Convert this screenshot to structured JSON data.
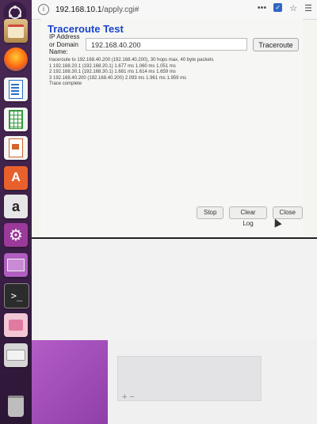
{
  "browser": {
    "url_host": "192.168.10.1",
    "url_path": "/apply.cgi#",
    "menu_icon": "hamburger-icon"
  },
  "dialog": {
    "title": "Traceroute Test",
    "label_lines": [
      "IP Address",
      "or Domain",
      "Name:"
    ],
    "ip_value": "192.168.40.200",
    "traceroute_button": "Traceroute",
    "log": [
      "traceroute to 192.168.40.200 (192.168.40.200), 30 hops max, 40 byte packets",
      "1 192.168.20.1 (192.168.20.1) 1.677 ms 1.060 ms 1.051 ms",
      "2 192.168.30.1 (192.168.30.1) 1.681 ms 1.614 ms 1.659 ms",
      "3 192.168.40.200 (192.168.40.200) 2.093 ms 1.961 ms 1.959 ms",
      "Trace complete"
    ],
    "stop_button": "Stop",
    "clear_log_button": "Clear Log",
    "close_button": "Close"
  },
  "bottom_panel": {
    "add_remove": "+ −"
  },
  "launcher": {
    "items": [
      {
        "icon": "ubuntu-logo-icon",
        "color": "#e95420"
      },
      {
        "icon": "files-icon",
        "color": "#c9a56a"
      },
      {
        "icon": "firefox-icon",
        "color": "#ff7a1a"
      },
      {
        "icon": "writer-icon",
        "color": "#2a6fc9"
      },
      {
        "icon": "calc-icon",
        "color": "#2e9b3a"
      },
      {
        "icon": "impress-icon",
        "color": "#d2632a"
      },
      {
        "icon": "software-center-icon",
        "color": "#e8612c"
      },
      {
        "icon": "amazon-icon",
        "color": "#dcdcdc"
      },
      {
        "icon": "settings-icon",
        "color": "#9b3a9b"
      },
      {
        "icon": "workspace-icon",
        "color": "#b05fc0"
      },
      {
        "icon": "terminal-icon",
        "color": "#2c2c2c"
      },
      {
        "icon": "network-icon",
        "color": "#e07aa0"
      },
      {
        "icon": "drive-icon",
        "color": "#cfcfcf"
      },
      {
        "icon": "trash-icon",
        "color": "#8a8a8a"
      }
    ]
  }
}
